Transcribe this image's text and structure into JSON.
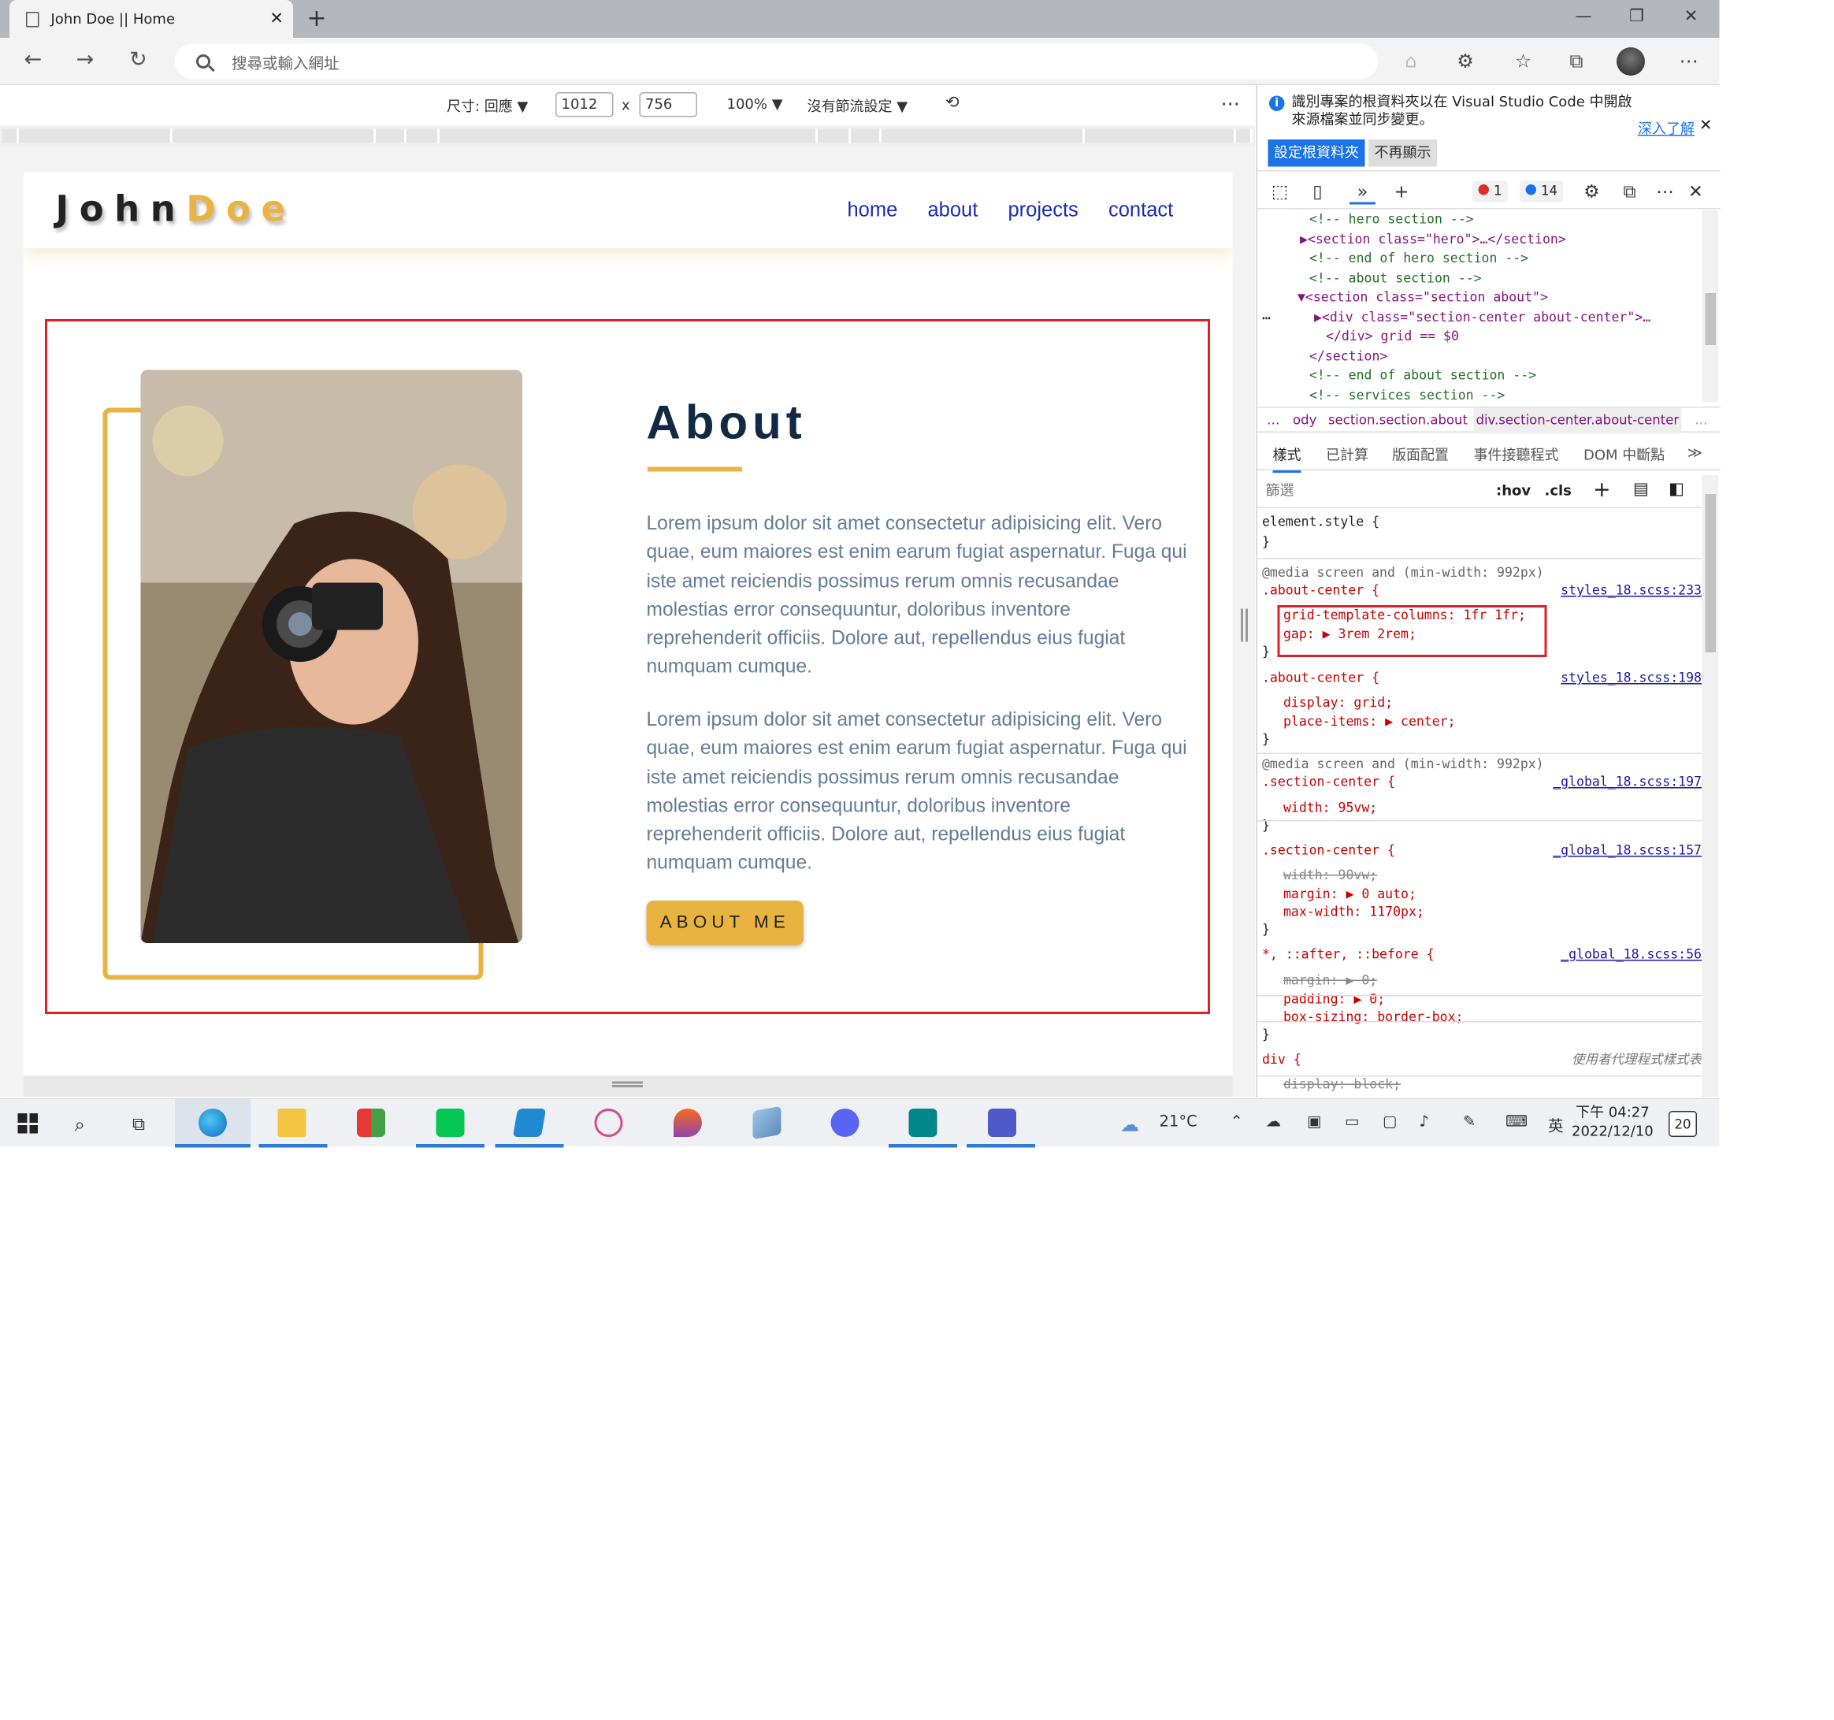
{
  "browser": {
    "tab_title": "John Doe || Home",
    "tab_close": "✕",
    "new_tab": "+",
    "url_placeholder": "搜尋或輸入網址"
  },
  "device_toolbar": {
    "dimensions_label": "尺寸: 回應",
    "width": "1012",
    "times": "x",
    "height": "756",
    "zoom": "100%",
    "throttle": "沒有節流設定",
    "more": "⋯"
  },
  "site": {
    "logo_first": "John",
    "logo_last": "Doe",
    "nav": [
      "home",
      "about",
      "projects",
      "contact"
    ],
    "about_title": "About",
    "paragraphs": [
      "Lorem ipsum dolor sit amet consectetur adipisicing elit. Vero quae, eum maiores est enim earum fugiat aspernatur. Fuga qui iste amet reiciendis possimus rerum omnis recusandae molestias error consequuntur, doloribus inventore reprehenderit officiis. Dolore aut, repellendus eius fugiat numquam cumque.",
      "Lorem ipsum dolor sit amet consectetur adipisicing elit. Vero quae, eum maiores est enim earum fugiat aspernatur. Fuga qui iste amet reiciendis possimus rerum omnis recusandae molestias error consequuntur, doloribus inventore reprehenderit officiis. Dolore aut, repellendus eius fugiat numquam cumque."
    ],
    "about_button": "ABOUT ME"
  },
  "devtools": {
    "info_text": "識別專案的根資料夾以在 Visual Studio Code 中開啟來源檔案並同步變更。",
    "learn_more": "深入了解",
    "close": "✕",
    "set_root_button": "設定根資料夾",
    "dont_show_button": "不再顯示",
    "error_count": "1",
    "message_count": "14",
    "dom_lines": [
      {
        "text": "<!-- hero section -->",
        "cls": "cmt"
      },
      {
        "text": "▶<section class=\"hero\">…</section>",
        "cls": "tag"
      },
      {
        "text": "<!-- end of hero section -->",
        "cls": "cmt"
      },
      {
        "text": "<!-- about section -->",
        "cls": "cmt"
      },
      {
        "text": "▼<section class=\"section about\">",
        "cls": "tag"
      },
      {
        "text": "▶<div class=\"section-center about-center\">…",
        "cls": "tag"
      },
      {
        "text": "</div> grid == $0",
        "cls": "tag"
      },
      {
        "text": "</section>",
        "cls": "tag"
      },
      {
        "text": "<!-- end of about section -->",
        "cls": "cmt"
      },
      {
        "text": "<!-- services section -->",
        "cls": "cmt"
      }
    ],
    "breadcrumbs": [
      "…",
      "ody",
      "section.section.about",
      "div.section-center.about-center",
      "…"
    ],
    "subtabs": [
      "樣式",
      "已計算",
      "版面配置",
      "事件接聽程式",
      "DOM 中斷點",
      "≫"
    ],
    "filter_placeholder": "篩選",
    "hov": ":hov",
    "cls": ".cls",
    "styles": [
      {
        "t": "element.style {",
        "k": "sel0"
      },
      {
        "t": "}",
        "k": "plain"
      },
      {
        "t": "@media screen and (min-width: 992px)",
        "k": "at"
      },
      {
        "t": ".about-center {",
        "k": "sel",
        "src": "styles_18.scss:233"
      },
      {
        "t": "grid-template-columns: 1fr 1fr;",
        "k": "prop"
      },
      {
        "t": "gap: ▶ 3rem 2rem;",
        "k": "prop"
      },
      {
        "t": "}",
        "k": "plain"
      },
      {
        "t": ".about-center {",
        "k": "sel",
        "src": "styles_18.scss:198"
      },
      {
        "t": "display: grid;",
        "k": "prop"
      },
      {
        "t": "place-items: ▶ center;",
        "k": "prop"
      },
      {
        "t": "}",
        "k": "plain"
      },
      {
        "t": "@media screen and (min-width: 992px)",
        "k": "at"
      },
      {
        "t": ".section-center {",
        "k": "sel",
        "src": "_global_18.scss:197"
      },
      {
        "t": "width: 95vw;",
        "k": "prop"
      },
      {
        "t": "}",
        "k": "plain"
      },
      {
        "t": ".section-center {",
        "k": "sel",
        "src": "_global_18.scss:157"
      },
      {
        "t": "width: 90vw;",
        "k": "strike"
      },
      {
        "t": "margin: ▶ 0 auto;",
        "k": "prop"
      },
      {
        "t": "max-width: 1170px;",
        "k": "prop"
      },
      {
        "t": "}",
        "k": "plain"
      },
      {
        "t": "*, ::after, ::before {",
        "k": "sel",
        "src": "_global_18.scss:56"
      },
      {
        "t": "margin: ▶ 0;",
        "k": "strike"
      },
      {
        "t": "padding: ▶ 0;",
        "k": "prop"
      },
      {
        "t": "box-sizing: border-box;",
        "k": "prop"
      },
      {
        "t": "}",
        "k": "plain"
      },
      {
        "t": "div {",
        "k": "sel",
        "src": "使用者代理程式樣式表"
      },
      {
        "t": "display: block;",
        "k": "strike"
      }
    ]
  },
  "taskbar": {
    "weather": "21°C",
    "ime": "英",
    "time": "下午 04:27",
    "date": "2022/12/10",
    "notifications": "20"
  },
  "colors": {
    "accent": "#e8b340",
    "nav_link": "#1a2cb8",
    "heading": "#102a43",
    "body_text": "#627d98",
    "highlight": "#e01f26"
  }
}
